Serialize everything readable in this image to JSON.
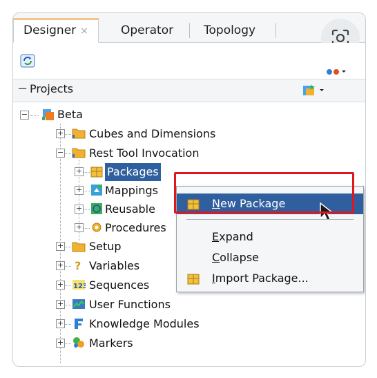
{
  "tabs": [
    {
      "label": "Designer",
      "active": true,
      "close": "×"
    },
    {
      "label": "Operator",
      "active": false
    },
    {
      "label": "Topology",
      "active": false
    }
  ],
  "toolbar": {
    "refresh_icon": "refresh-icon",
    "connect_icon": "connect-icon"
  },
  "section": {
    "title": "Projects",
    "collapse_glyph": "−"
  },
  "tree": {
    "root": "Beta",
    "folders": {
      "cubes": "Cubes and Dimensions",
      "rest": "Rest Tool Invocation",
      "setup": "Setup"
    },
    "rest_children": {
      "packages": "Packages",
      "mapping": "Mappings",
      "reusable": "Reusable",
      "procedures": "Procedures"
    },
    "bottom": {
      "variables": "Variables",
      "sequences": "Sequences",
      "user_functions": "User Functions",
      "knowledge_modules": "Knowledge Modules",
      "markers": "Markers"
    }
  },
  "context_menu": {
    "new_package_mn": "N",
    "new_package_rest": "ew Package",
    "expand_mn": "E",
    "expand_rest": "xpand",
    "collapse_mn": "C",
    "collapse_rest": "ollapse",
    "import_mn": "I",
    "import_rest": "mport Package..."
  },
  "colors": {
    "highlight": "#2f5f9e",
    "annotation_border": "#e0171f",
    "folder": "#f0b030"
  }
}
